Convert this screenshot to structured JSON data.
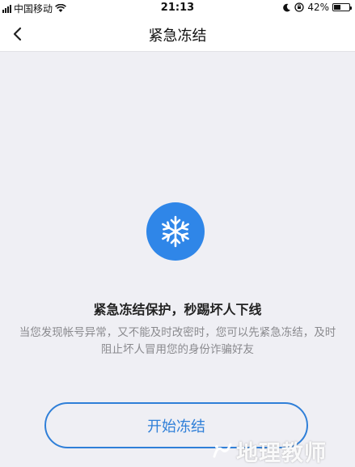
{
  "status_bar": {
    "carrier": "中国移动",
    "time": "21:13",
    "battery_percent": "42%",
    "battery_level": 0.42,
    "icons": [
      "signal-icon",
      "wifi-icon",
      "moon-icon",
      "orientation-lock-icon",
      "battery-icon"
    ]
  },
  "nav": {
    "title": "紧急冻结",
    "back_icon": "chevron-left-icon"
  },
  "main": {
    "icon": "snowflake-icon",
    "accent_color": "#2f86e8",
    "headline": "紧急冻结保护，秒踢坏人下线",
    "description": "当您发现帐号异常，又不能及时改密时，您可以先紧急冻结，及时阻止坏人冒用您的身份诈骗好友",
    "start_button_label": "开始冻结"
  },
  "watermark": {
    "text": "地理教师"
  }
}
